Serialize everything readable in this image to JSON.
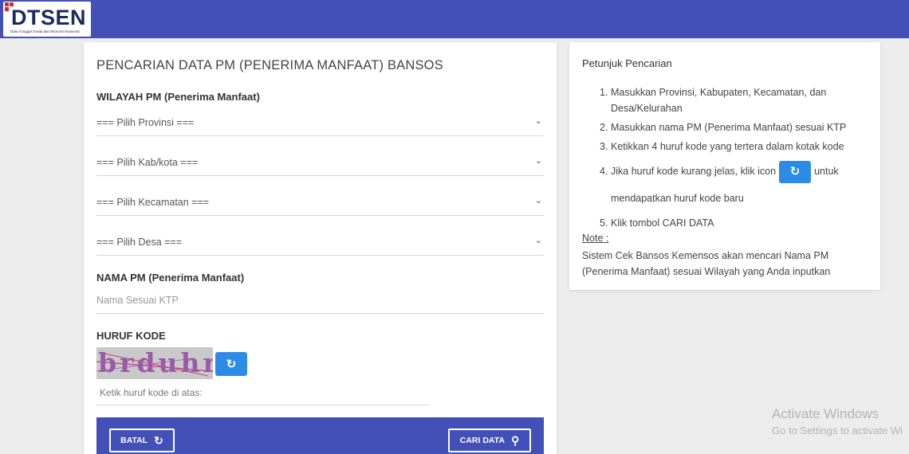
{
  "header": {
    "logo_text": "DTSEN",
    "logo_sub": "Data Tunggal Sosial dan Ekonomi Nasional",
    "brand_color": "#4350b8"
  },
  "form": {
    "title": "PENCARIAN DATA PM (PENERIMA MANFAAT) BANSOS",
    "wilayah_label": "WILAYAH PM (Penerima Manfaat)",
    "provinsi": "=== Pilih Provinsi ===",
    "kabkota": "=== Pilih Kab/kota ===",
    "kecamatan": "=== Pilih Kecamatan ===",
    "desa": "=== Pilih Desa ===",
    "nama_label": "NAMA PM (Penerima Manfaat)",
    "nama_placeholder": "Nama Sesuai KTP",
    "kode_label": "HURUF KODE",
    "captcha_text": "brduhr",
    "kode_placeholder": "Ketik huruf kode di atas:",
    "batal_label": "BATAL",
    "cari_label": "CARI DATA",
    "button_color": "#2b8be6"
  },
  "petunjuk": {
    "title": "Petunjuk Pencarian",
    "steps": [
      {
        "num": "1.",
        "text": "Masukkan Provinsi, Kabupaten, Kecamatan, dan Desa/Kelurahan"
      },
      {
        "num": "2.",
        "text": "Masukkan nama PM (Penerima Manfaat) sesuai KTP"
      },
      {
        "num": "3.",
        "text": "Ketikkan 4 huruf kode yang tertera dalam kotak kode"
      },
      {
        "num": "4.",
        "text_before": "Jika huruf kode kurang jelas, klik icon",
        "text_after": "untuk mendapatkan huruf kode baru"
      },
      {
        "num": "5.",
        "text": "Klik tombol CARI DATA"
      }
    ],
    "note_label": "Note :",
    "note_text": "Sistem Cek Bansos Kemensos akan mencari Nama PM (Penerima Manfaat) sesuai Wilayah yang Anda inputkan"
  },
  "watermark": {
    "line1": "Activate Windows",
    "line2": "Go to Settings to activate Wi"
  }
}
